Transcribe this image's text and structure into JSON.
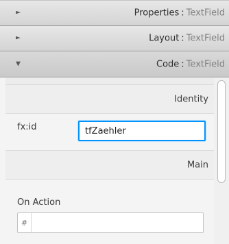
{
  "accordion": [
    {
      "label": "Properties",
      "separator": ":",
      "type": "TextField",
      "arrow": "►",
      "expanded": false
    },
    {
      "label": "Layout",
      "separator": ":",
      "type": "TextField",
      "arrow": "►",
      "expanded": false
    },
    {
      "label": "Code",
      "separator": ":",
      "type": "TextField",
      "arrow": "▼",
      "expanded": true
    }
  ],
  "code": {
    "identity_header": "Identity",
    "fxid_label": "fx:id",
    "fxid_value": "tfZaehler",
    "main_header": "Main",
    "on_action_label": "On Action",
    "on_action_prefix": "#",
    "on_action_value": ""
  }
}
